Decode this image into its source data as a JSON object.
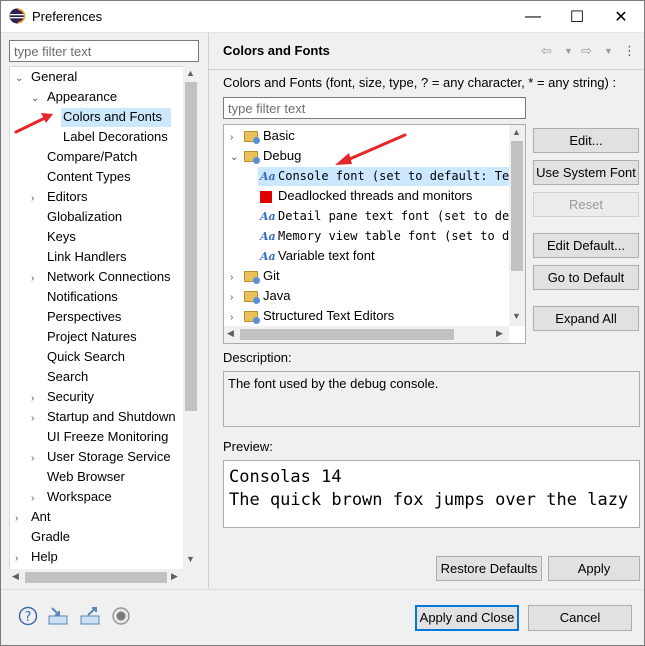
{
  "window": {
    "title": "Preferences",
    "controls": {
      "minimize": "—",
      "maximize": "☐",
      "close": "✕"
    }
  },
  "left": {
    "filter_placeholder": "type filter text",
    "tree": [
      {
        "label": "General",
        "indent": 0,
        "arrow": "⌄"
      },
      {
        "label": "Appearance",
        "indent": 1,
        "arrow": "⌄"
      },
      {
        "label": "Colors and Fonts",
        "indent": 2,
        "arrow": "",
        "selected": true
      },
      {
        "label": "Label Decorations",
        "indent": 2,
        "arrow": ""
      },
      {
        "label": "Compare/Patch",
        "indent": 1,
        "arrow": ""
      },
      {
        "label": "Content Types",
        "indent": 1,
        "arrow": ""
      },
      {
        "label": "Editors",
        "indent": 1,
        "arrow": "›"
      },
      {
        "label": "Globalization",
        "indent": 1,
        "arrow": ""
      },
      {
        "label": "Keys",
        "indent": 1,
        "arrow": ""
      },
      {
        "label": "Link Handlers",
        "indent": 1,
        "arrow": ""
      },
      {
        "label": "Network Connections",
        "indent": 1,
        "arrow": "›"
      },
      {
        "label": "Notifications",
        "indent": 1,
        "arrow": ""
      },
      {
        "label": "Perspectives",
        "indent": 1,
        "arrow": ""
      },
      {
        "label": "Project Natures",
        "indent": 1,
        "arrow": ""
      },
      {
        "label": "Quick Search",
        "indent": 1,
        "arrow": ""
      },
      {
        "label": "Search",
        "indent": 1,
        "arrow": ""
      },
      {
        "label": "Security",
        "indent": 1,
        "arrow": "›"
      },
      {
        "label": "Startup and Shutdown",
        "indent": 1,
        "arrow": "›"
      },
      {
        "label": "UI Freeze Monitoring",
        "indent": 1,
        "arrow": ""
      },
      {
        "label": "User Storage Service",
        "indent": 1,
        "arrow": "›"
      },
      {
        "label": "Web Browser",
        "indent": 1,
        "arrow": ""
      },
      {
        "label": "Workspace",
        "indent": 1,
        "arrow": "›"
      },
      {
        "label": "Ant",
        "indent": 0,
        "arrow": "›"
      },
      {
        "label": "Gradle",
        "indent": 0,
        "arrow": ""
      },
      {
        "label": "Help",
        "indent": 0,
        "arrow": "›"
      }
    ]
  },
  "right": {
    "title": "Colors and Fonts",
    "description_line": "Colors and Fonts (font, size, type, ? = any character, * = any string) :",
    "filter_placeholder": "type filter text",
    "tree": [
      {
        "label": "Basic",
        "kind": "folder",
        "arrow": "›",
        "indent": 0
      },
      {
        "label": "Debug",
        "kind": "folder",
        "arrow": "⌄",
        "indent": 0
      },
      {
        "label": "Console font (set to default: Tex",
        "kind": "font",
        "indent": 1,
        "selected": true
      },
      {
        "label": "Deadlocked threads and monitors",
        "kind": "color",
        "indent": 1
      },
      {
        "label": "Detail pane text font (set to def",
        "kind": "font",
        "indent": 1
      },
      {
        "label": "Memory view table font (set to de",
        "kind": "font",
        "indent": 1
      },
      {
        "label": "Variable text font",
        "kind": "font-sans",
        "indent": 1
      },
      {
        "label": "Git",
        "kind": "folder",
        "arrow": "›",
        "indent": 0
      },
      {
        "label": "Java",
        "kind": "folder",
        "arrow": "›",
        "indent": 0
      },
      {
        "label": "Structured Text Editors",
        "kind": "folder",
        "arrow": "›",
        "indent": 0
      }
    ],
    "buttons": {
      "edit": "Edit...",
      "use_system_font": "Use System Font",
      "reset": "Reset",
      "edit_default": "Edit Default...",
      "go_to_default": "Go to Default",
      "expand_all": "Expand All"
    },
    "description_label": "Description:",
    "description_text": "The font used by the debug console.",
    "preview_label": "Preview:",
    "preview_line1": "Consolas 14",
    "preview_line2": "The quick brown fox jumps over the lazy d",
    "restore_defaults": "Restore Defaults",
    "apply": "Apply"
  },
  "footer": {
    "apply_and_close": "Apply and Close",
    "cancel": "Cancel",
    "icons": [
      "help-icon",
      "import-icon",
      "export-icon",
      "record-icon"
    ]
  },
  "colors": {
    "selection": "#cce8ff",
    "accent": "#0078d7",
    "annotation": "#e8262a"
  }
}
